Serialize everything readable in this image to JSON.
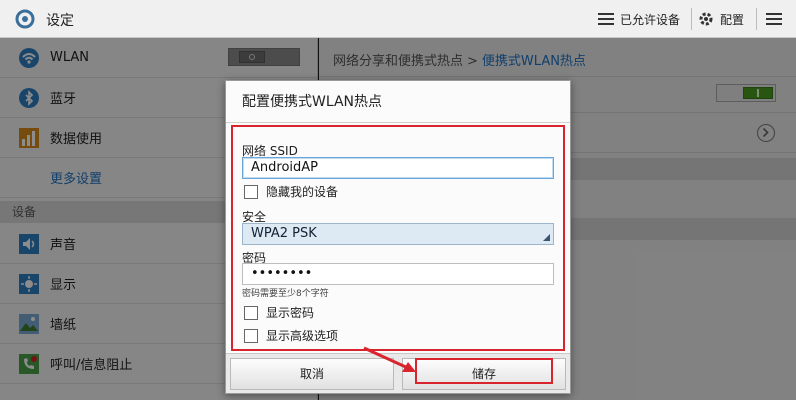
{
  "topbar": {
    "title": "设定",
    "allowed_devices": "已允许设备",
    "configure": "配置"
  },
  "sidebar": {
    "items": [
      {
        "label": "WLAN",
        "icon": "wifi-icon"
      },
      {
        "label": "蓝牙",
        "icon": "bluetooth-icon"
      },
      {
        "label": "数据使用",
        "icon": "data-usage-icon"
      },
      {
        "label": "更多设置",
        "icon": ""
      }
    ],
    "device_section": "设备",
    "device_items": [
      {
        "label": "声音",
        "icon": "sound-icon"
      },
      {
        "label": "显示",
        "icon": "display-icon"
      },
      {
        "label": "墙纸",
        "icon": "wallpaper-icon"
      },
      {
        "label": "呼叫/信息阻止",
        "icon": "call-block-icon"
      }
    ]
  },
  "main": {
    "breadcrumb_parent": "网络分享和便携式热点",
    "breadcrumb_sep": ">",
    "breadcrumb_current": "便携式WLAN热点"
  },
  "dialog": {
    "title": "配置便携式WLAN热点",
    "ssid_label": "网络 SSID",
    "ssid_value": "AndroidAP",
    "hide_device_label": "隐藏我的设备",
    "security_label": "安全",
    "security_value": "WPA2 PSK",
    "password_label": "密码",
    "password_value": "••••••••",
    "password_hint": "密码需要至少8个字符",
    "show_password_label": "显示密码",
    "show_advanced_label": "显示高级选项",
    "cancel_label": "取消",
    "save_label": "储存"
  },
  "colors": {
    "accent_blue": "#1f74c4",
    "highlight_red": "#d9232d",
    "toggle_green": "#4a9d1f"
  }
}
